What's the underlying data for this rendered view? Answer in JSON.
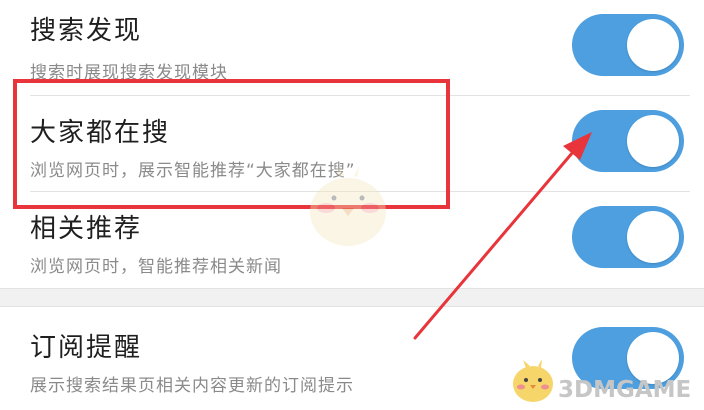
{
  "settings": [
    {
      "title": "搜索发现",
      "desc": "搜索时展现搜索发现模块",
      "enabled": true
    },
    {
      "title": "大家都在搜",
      "desc": "浏览网页时，展示智能推荐“大家都在搜”",
      "enabled": true
    },
    {
      "title": "相关推荐",
      "desc": "浏览网页时，智能推荐相关新闻",
      "enabled": true
    },
    {
      "title": "订阅提醒",
      "desc": "展示搜索结果页相关内容更新的订阅提示",
      "enabled": true
    }
  ],
  "colors": {
    "toggle_on": "#4d9fe0",
    "highlight": "#e8343b"
  },
  "watermark": {
    "text": "3DMGAME"
  }
}
